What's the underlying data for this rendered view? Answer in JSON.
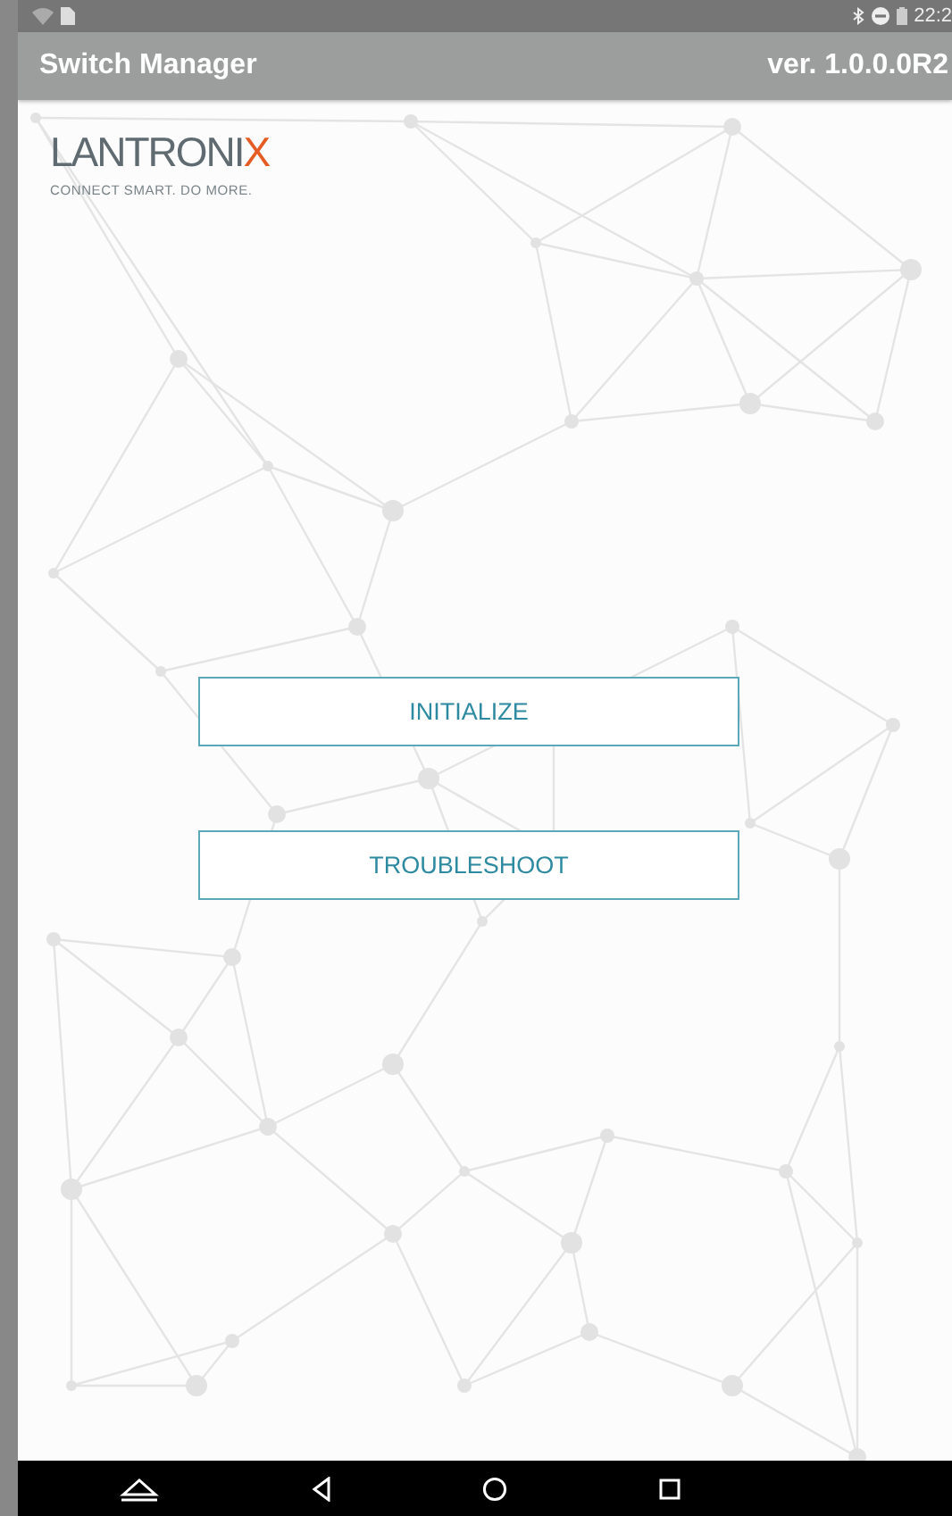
{
  "status_bar": {
    "time": "22:2"
  },
  "app_bar": {
    "title": "Switch Manager",
    "version": "ver. 1.0.0.0R2"
  },
  "logo": {
    "wordmark": "LANTRONI",
    "wordmark_accent": "X",
    "tagline": "CONNECT SMART. DO MORE."
  },
  "buttons": [
    {
      "label": "INITIALIZE"
    },
    {
      "label": "TROUBLESHOOT"
    }
  ]
}
